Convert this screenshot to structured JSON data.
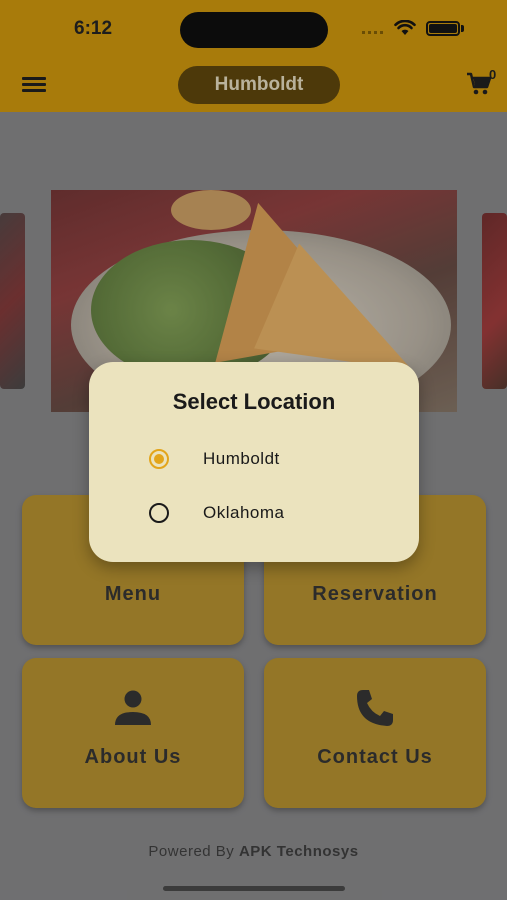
{
  "status_bar": {
    "time": "6:12"
  },
  "app_bar": {
    "location_button_label": "Humboldt",
    "cart_count": "0"
  },
  "tiles": [
    {
      "label": "Menu",
      "icon": "menu-book-icon"
    },
    {
      "label": "Reservation",
      "icon": "calendar-icon"
    },
    {
      "label": "About Us",
      "icon": "person-icon"
    },
    {
      "label": "Contact Us",
      "icon": "phone-icon"
    }
  ],
  "footer": {
    "prefix": "Powered By",
    "brand": "APK Technosys"
  },
  "dialog": {
    "title": "Select Location",
    "options": [
      {
        "label": "Humboldt",
        "selected": true
      },
      {
        "label": "Oklahoma",
        "selected": false
      }
    ]
  },
  "colors": {
    "app_bar": "#a87b0b",
    "tile": "#a1790f",
    "dialog_bg": "#ebe3be",
    "radio_selected": "#e3a51b"
  }
}
